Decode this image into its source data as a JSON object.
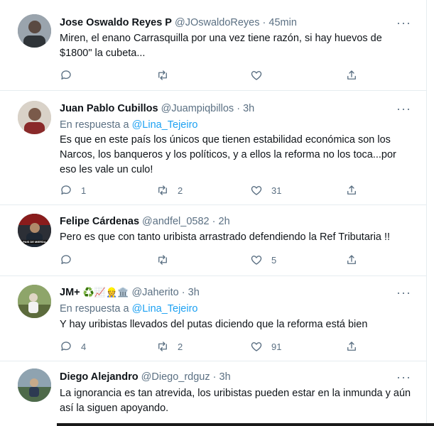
{
  "tweets": [
    {
      "name": "Jose Oswaldo Reyes P",
      "handle": "@JOswaldoReyes",
      "time": "45min",
      "reply_prefix": "",
      "reply_to": "",
      "text": "Miren, el enano Carrasquilla por una vez tiene razón, si hay huevos de $1800\" la cubeta...",
      "replies": "",
      "retweets": "",
      "likes": ""
    },
    {
      "name": "Juan Pablo Cubillos",
      "handle": "@Juampiqbillos",
      "time": "3h",
      "reply_prefix": "En respuesta a",
      "reply_to": "@Lina_Tejeiro",
      "text": "Es que en este país los únicos que tienen estabilidad económica son los Narcos, los banqueros y los políticos, y a ellos la reforma no los toca...por eso les vale un culo!",
      "replies": "1",
      "retweets": "2",
      "likes": "31"
    },
    {
      "name": "Felipe Cárdenas",
      "handle": "@andfel_0582",
      "time": "2h",
      "reply_prefix": "",
      "reply_to": "",
      "text": "Pero es que con tanto uribista arrastrado defendiendo la Ref Tributaria !!",
      "replies": "",
      "retweets": "",
      "likes": "5",
      "avatar_caption": "PAIS DE MIERDA"
    },
    {
      "name": "JM+",
      "name_emoji": "♻️📈👷🏛️",
      "handle": "@Jaherito",
      "time": "3h",
      "reply_prefix": "En respuesta a",
      "reply_to": "@Lina_Tejeiro",
      "text": "Y hay uribistas llevados del putas diciendo que la reforma está bien",
      "replies": "4",
      "retweets": "2",
      "likes": "91"
    },
    {
      "name": "Diego Alejandro",
      "handle": "@Diego_rdguz",
      "time": "3h",
      "reply_prefix": "",
      "reply_to": "",
      "text": "La ignorancia es tan atrevida, los uribistas pueden estar en la inmunda y aún así la siguen apoyando.",
      "replies": "",
      "retweets": "",
      "likes": ""
    }
  ],
  "separator": "·",
  "more_glyph": "···",
  "colors": {
    "accent": "#1da1f2",
    "secondary": "#5b7083",
    "divider": "#e6ecf0"
  }
}
